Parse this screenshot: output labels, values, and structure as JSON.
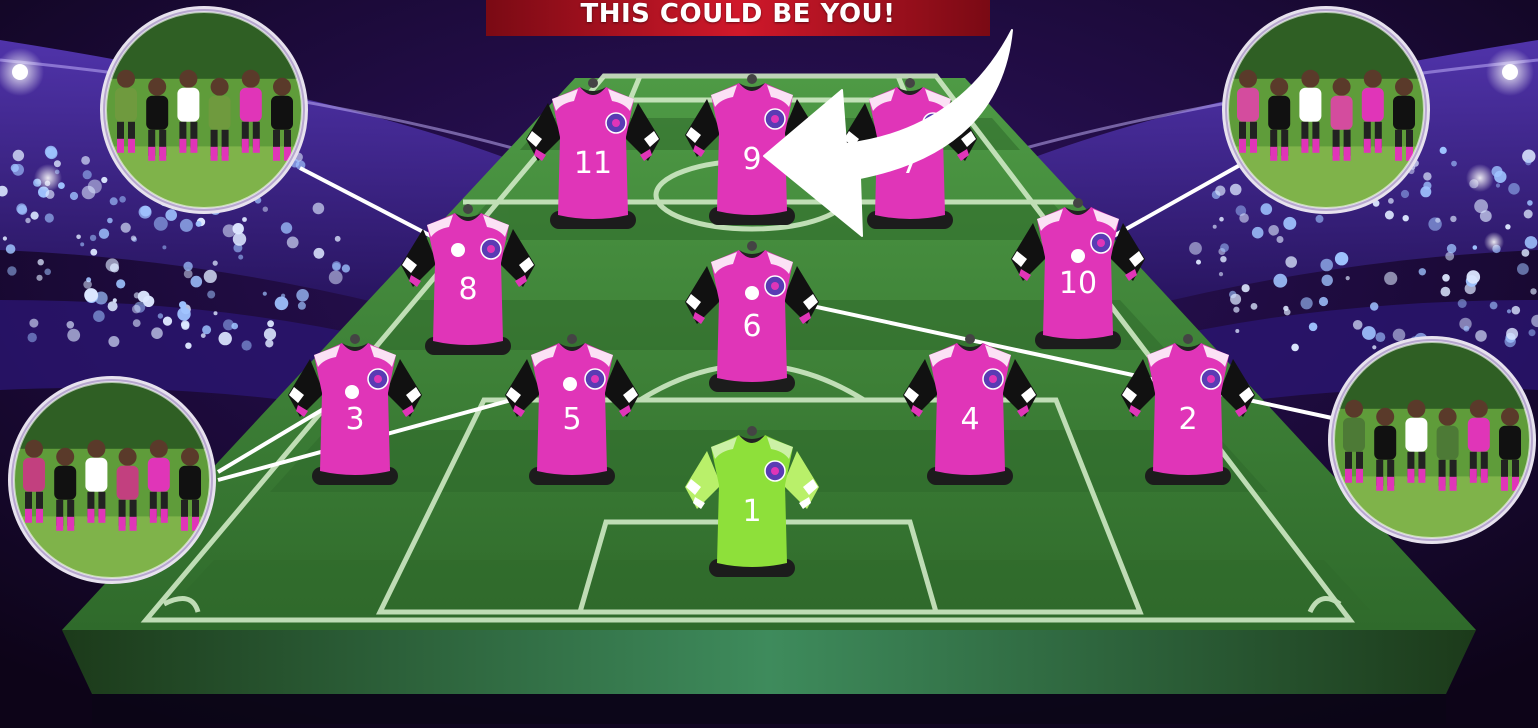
{
  "banner": {
    "text": "THIS COULD BE YOU!"
  },
  "colors": {
    "background": "#12061f",
    "stand_purple": "#3b1d8a",
    "banner_red": "#c01422",
    "pitch_green": "#3e8b3b",
    "pitch_dark": "#2a5b27",
    "line_color": "#cfe9c4",
    "jersey_pink": "#e035b8",
    "jersey_black": "#111111",
    "keeper_green": "#8ee03a",
    "connector": "#ffffff"
  },
  "players": [
    {
      "number": "11",
      "kind": "outfield"
    },
    {
      "number": "9",
      "kind": "outfield"
    },
    {
      "number": "7",
      "kind": "outfield"
    },
    {
      "number": "8",
      "kind": "outfield"
    },
    {
      "number": "6",
      "kind": "outfield"
    },
    {
      "number": "10",
      "kind": "outfield"
    },
    {
      "number": "3",
      "kind": "outfield"
    },
    {
      "number": "5",
      "kind": "outfield"
    },
    {
      "number": "4",
      "kind": "outfield"
    },
    {
      "number": "2",
      "kind": "outfield"
    },
    {
      "number": "1",
      "kind": "goalkeeper"
    }
  ],
  "photos": [
    {
      "subject": "player-dribbling-photo",
      "tone": "#6f9a3e"
    },
    {
      "subject": "team-selfie-photo",
      "tone": "#d44c9e"
    },
    {
      "subject": "team-huddle-photo",
      "tone": "#c2407f"
    },
    {
      "subject": "team-group-photo",
      "tone": "#4d7a36"
    }
  ],
  "icons": {
    "arrow": "curved-arrow-icon",
    "crest": "club-crest-icon"
  }
}
